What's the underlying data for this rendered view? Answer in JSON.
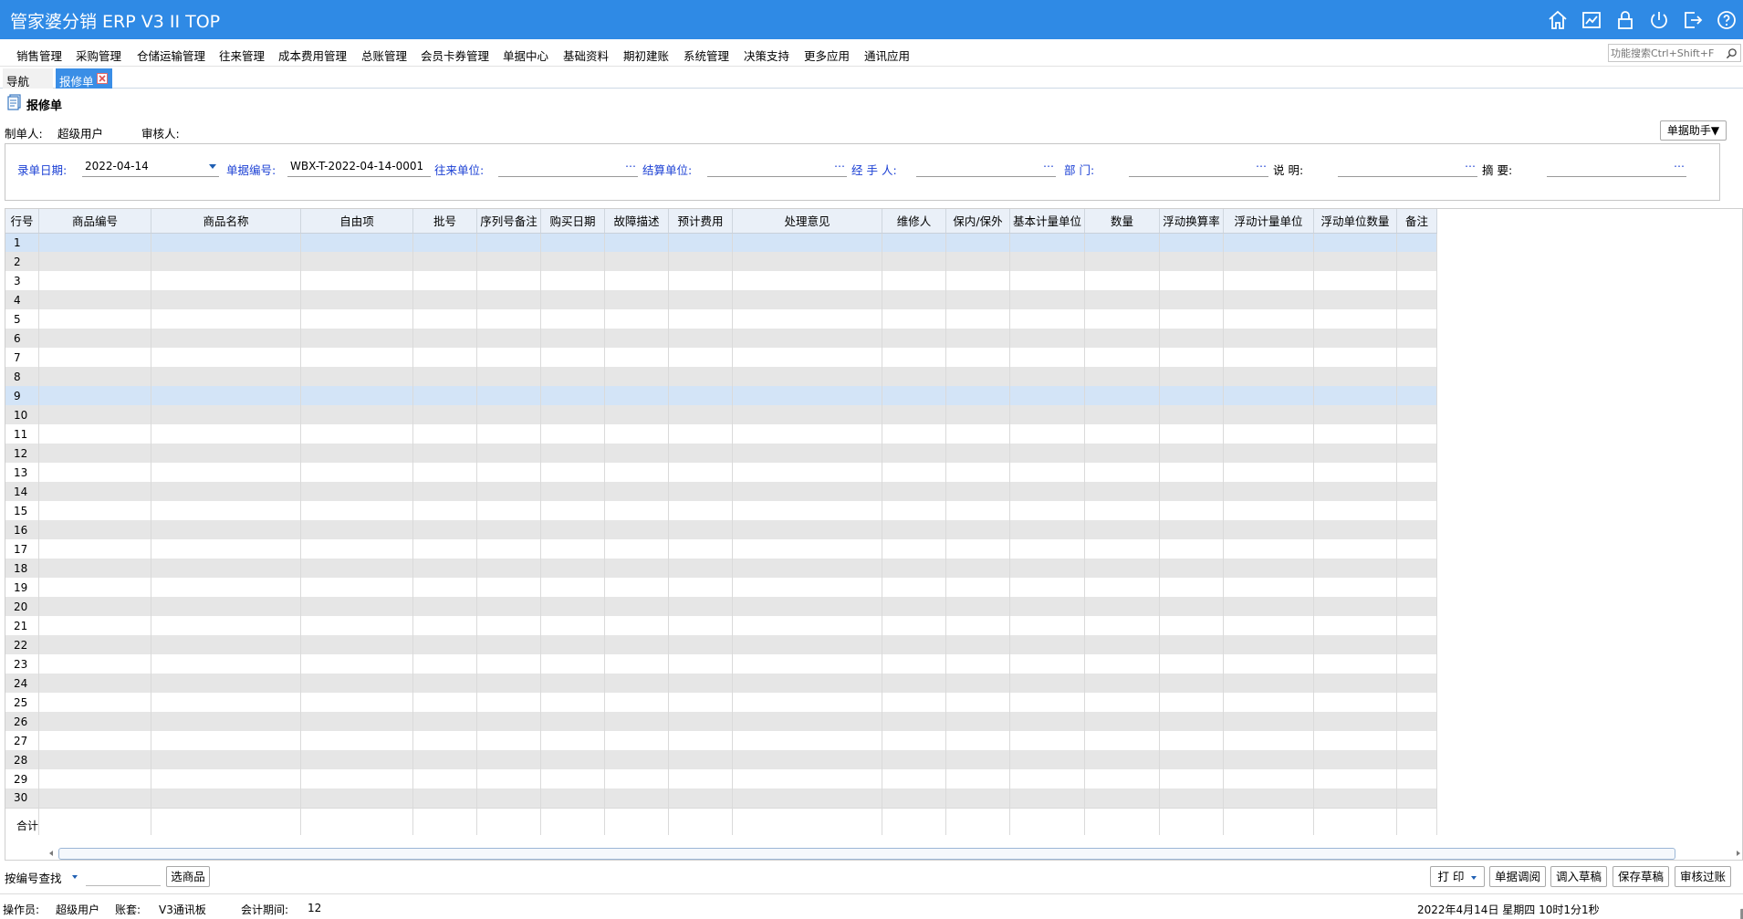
{
  "app": {
    "title": "管家婆分销 ERP V3 II TOP"
  },
  "menu": {
    "items": [
      "销售管理",
      "采购管理",
      "仓储运输管理",
      "往来管理",
      "成本费用管理",
      "总账管理",
      "会员卡券管理",
      "单据中心",
      "基础资料",
      "期初建账",
      "系统管理",
      "决策支持",
      "更多应用",
      "通讯应用"
    ],
    "search_placeholder": "功能搜索Ctrl+Shift+F"
  },
  "tabs": {
    "nav": "导航",
    "active": "报修单"
  },
  "page": {
    "title": "报修单",
    "creator_label": "制单人:",
    "creator_value": "超级用户",
    "reviewer_label": "审核人:",
    "helper_button": "单据助手▼"
  },
  "form": {
    "date_label": "录单日期:",
    "date_value": "2022-04-14",
    "docno_label": "单据编号:",
    "docno_value": "WBX-T-2022-04-14-0001",
    "partner_label": "往来单位:",
    "settle_label": "结算单位:",
    "handler_label": "经  手  人:",
    "dept_label": "部      门:",
    "desc_label": "说      明:",
    "summary_label": "摘      要:",
    "dots": "…"
  },
  "grid": {
    "columns": [
      "行号",
      "商品编号",
      "商品名称",
      "自由项",
      "批号",
      "序列号备注",
      "购买日期",
      "故障描述",
      "预计费用",
      "处理意见",
      "维修人",
      "保内/保外",
      "基本计量单位",
      "数量",
      "浮动换算率",
      "浮动计量单位",
      "浮动单位数量",
      "备注"
    ],
    "row_numbers": [
      "1",
      "2",
      "3",
      "4",
      "5",
      "6",
      "7",
      "8",
      "9",
      "10",
      "11",
      "12",
      "13",
      "14",
      "15",
      "16",
      "17",
      "18",
      "19",
      "20",
      "21",
      "22",
      "23",
      "24",
      "25",
      "26",
      "27",
      "28",
      "29",
      "30"
    ],
    "selected_rows": [
      1,
      9
    ],
    "total_label": "合计"
  },
  "bottom": {
    "lookup_mode": "按编号查找",
    "select_goods": "选商品",
    "print": "打 印",
    "doc_review": "单据调阅",
    "load_draft": "调入草稿",
    "save_draft": "保存草稿",
    "approve_post": "审核过账"
  },
  "status": {
    "operator_label": "操作员:",
    "operator_value": "超级用户",
    "account_label": "账套:",
    "account_value": "V3通讯板",
    "period_label": "会计期间:",
    "period_value": "12",
    "datetime": "2022年4月14日 星期四 10时1分1秒"
  },
  "colors": {
    "titlebar": "#2f8ae5",
    "active_tab": "#3a8ee6",
    "field_label_blue": "#1a3fd4",
    "row_selected": "#d3e4f7",
    "row_alt": "#e6e6e6",
    "header_bg": "#eaf0f8"
  },
  "icons": [
    "home-icon",
    "chart-icon",
    "lock-icon",
    "power-icon",
    "exit-icon",
    "help-icon",
    "search-icon",
    "close-icon",
    "document-icon",
    "chat-icon",
    "calendar-icon",
    "apps-icon",
    "tools-icon",
    "home-small-icon"
  ]
}
